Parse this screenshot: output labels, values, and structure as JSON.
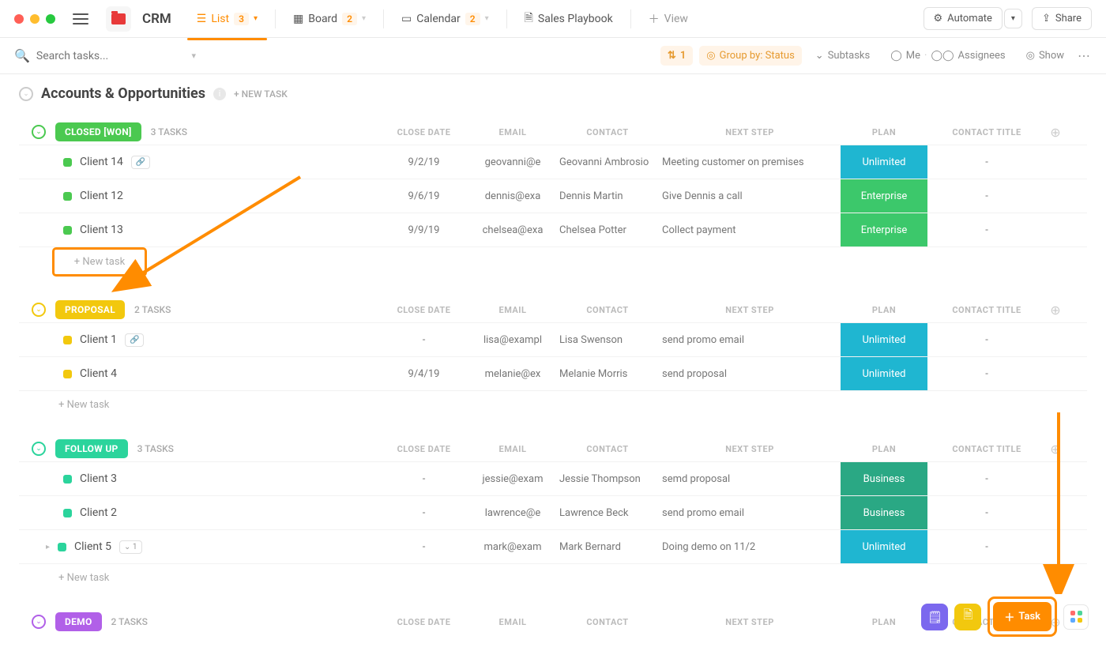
{
  "header": {
    "workspace": "CRM",
    "views": [
      {
        "icon": "list",
        "label": "List",
        "count": "3",
        "active": true
      },
      {
        "icon": "board",
        "label": "Board",
        "count": "2"
      },
      {
        "icon": "calendar",
        "label": "Calendar",
        "count": "2"
      },
      {
        "icon": "doc",
        "label": "Sales Playbook"
      },
      {
        "icon": "plus",
        "label": "View"
      }
    ],
    "automate": "Automate",
    "share": "Share"
  },
  "toolbar": {
    "search_placeholder": "Search tasks...",
    "filter_count": "1",
    "groupby": "Group by: Status",
    "subtasks": "Subtasks",
    "me": "Me",
    "assignees": "Assignees",
    "show": "Show"
  },
  "section": {
    "title": "Accounts & Opportunities",
    "new_task_label": "+ NEW TASK"
  },
  "columns": [
    "CLOSE DATE",
    "EMAIL",
    "CONTACT",
    "NEXT STEP",
    "PLAN",
    "CONTACT TITLE"
  ],
  "groups": [
    {
      "name": "CLOSED [WON]",
      "color": "#4bc950",
      "chev": "#4bc950",
      "count": "3 TASKS",
      "rows": [
        {
          "name": "Client 14",
          "link": true,
          "close": "9/2/19",
          "email": "geovanni@e",
          "contact": "Geovanni Ambrosio",
          "next": "Meeting customer on premises",
          "plan": "Unlimited",
          "plan_color": "#1fb6d1",
          "title": "-"
        },
        {
          "name": "Client 12",
          "close": "9/6/19",
          "email": "dennis@exa",
          "contact": "Dennis Martin",
          "next": "Give Dennis a call",
          "plan": "Enterprise",
          "plan_color": "#3cc86b",
          "title": "-"
        },
        {
          "name": "Client 13",
          "close": "9/9/19",
          "email": "chelsea@exa",
          "contact": "Chelsea Potter",
          "next": "Collect payment",
          "plan": "Enterprise",
          "plan_color": "#3cc86b",
          "title": "-"
        }
      ],
      "new_task": "+ New task",
      "boxed": true
    },
    {
      "name": "PROPOSAL",
      "color": "#f2c80e",
      "chev": "#f2c80e",
      "count": "2 TASKS",
      "rows": [
        {
          "name": "Client 1",
          "link": true,
          "close": "-",
          "email": "lisa@exampl",
          "contact": "Lisa Swenson",
          "next": "send promo email",
          "plan": "Unlimited",
          "plan_color": "#1fb6d1",
          "title": "-"
        },
        {
          "name": "Client 4",
          "close": "9/4/19",
          "email": "melanie@ex",
          "contact": "Melanie Morris",
          "next": "send proposal",
          "plan": "Unlimited",
          "plan_color": "#1fb6d1",
          "title": "-"
        }
      ],
      "new_task": "+ New task"
    },
    {
      "name": "FOLLOW UP",
      "color": "#2bd49c",
      "chev": "#2bd49c",
      "count": "3 TASKS",
      "rows": [
        {
          "name": "Client 3",
          "close": "-",
          "email": "jessie@exam",
          "contact": "Jessie Thompson",
          "next": "semd proposal",
          "plan": "Business",
          "plan_color": "#2aa884",
          "title": "-"
        },
        {
          "name": "Client 2",
          "close": "-",
          "email": "lawrence@e",
          "contact": "Lawrence Beck",
          "next": "send promo email",
          "plan": "Business",
          "plan_color": "#2aa884",
          "title": "-"
        },
        {
          "name": "Client 5",
          "sub": "1",
          "close": "-",
          "email": "mark@exam",
          "contact": "Mark Bernard",
          "next": "Doing demo on 11/2",
          "plan": "Unlimited",
          "plan_color": "#1fb6d1",
          "title": "-"
        }
      ],
      "new_task": "+ New task"
    },
    {
      "name": "DEMO",
      "color": "#b160e8",
      "chev": "#b160e8",
      "count": "2 TASKS",
      "rows": [],
      "header_only": true
    }
  ],
  "float": {
    "task": "Task"
  }
}
